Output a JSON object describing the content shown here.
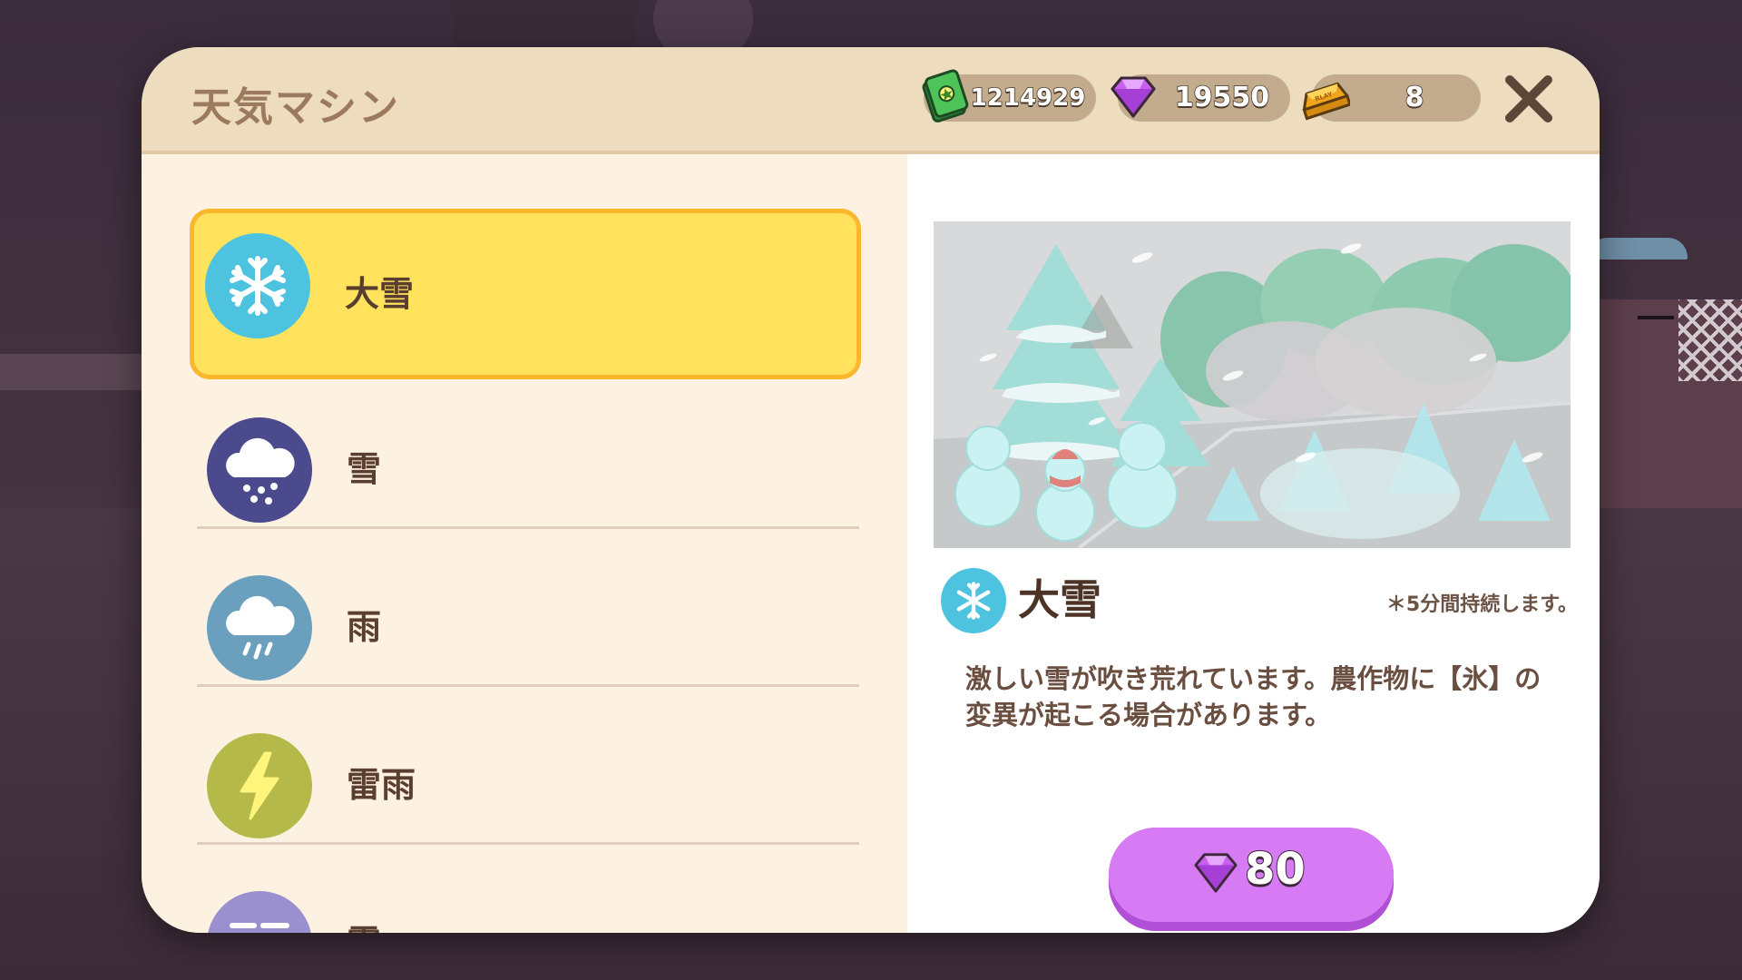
{
  "header": {
    "title": "天気マシン",
    "currencies": [
      {
        "name": "cash",
        "value": "1214929",
        "icon": "cash-icon"
      },
      {
        "name": "gem",
        "value": "19550",
        "icon": "gem-icon"
      },
      {
        "name": "gold-bar",
        "value": "8",
        "icon": "gold-bar-icon",
        "icon_text": "RLAY"
      }
    ],
    "close_icon": "close-icon"
  },
  "weather_list": [
    {
      "label": "大雪",
      "icon": "snowflake-icon",
      "color": "#4ec3df",
      "selected": true
    },
    {
      "label": "雪",
      "icon": "snow-cloud-icon",
      "color": "#4b4a8c",
      "selected": false
    },
    {
      "label": "雨",
      "icon": "rain-cloud-icon",
      "color": "#6aa0bd",
      "selected": false
    },
    {
      "label": "雷雨",
      "icon": "lightning-icon",
      "color": "#b5b94a",
      "selected": false
    },
    {
      "label": "霧",
      "icon": "fog-icon",
      "color": "#9a8fcf",
      "selected": false
    }
  ],
  "detail": {
    "name": "大雪",
    "icon": "snowflake-icon",
    "duration": "＊5分間持続します。",
    "description_lines": [
      "激しい雪が吹き荒れています。農作物に【氷】の",
      "変異が起こる場合があります。"
    ],
    "price": "80",
    "price_icon": "gem-icon"
  },
  "colors": {
    "header_bg": "#eedcbf",
    "list_bg": "#fdf1e2",
    "selected_bg": "#ffe35c",
    "selected_border": "#fbb62b",
    "buy_button": "#d77bf4",
    "title_text": "#9b7a5e"
  }
}
